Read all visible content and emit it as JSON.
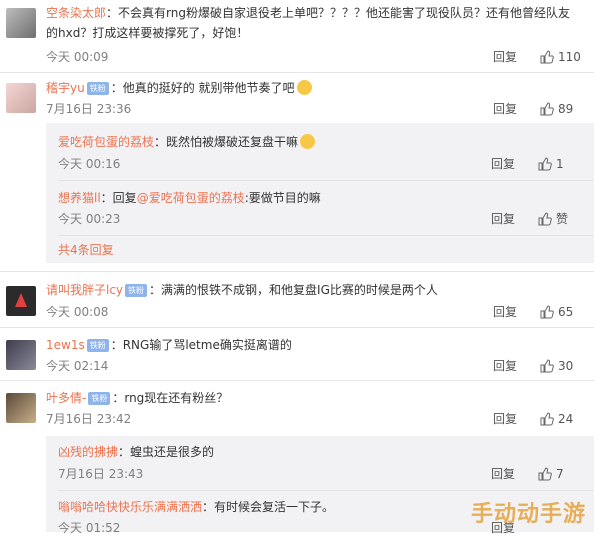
{
  "colors": {
    "username": "#eb7350",
    "badge": "#8fb4ea",
    "watermark": "#e6a23c"
  },
  "icons": {
    "like": "thumbs-up-icon"
  },
  "comments": [
    {
      "user": "空条染太郎",
      "text": "：不会真有rng粉爆破自家退役老上单吧？？？？他还能害了现役队员？还有他曾经队友的hxd？打成这样要被撑死了，好饱！",
      "time": "今天 00:09",
      "reply": "回复",
      "likes": "110"
    },
    {
      "user": "稽宇yu",
      "badge": "铁粉",
      "text": "：他真的挺好的 就别带他节奏了吧",
      "time": "7月16日 23:36",
      "reply": "回复",
      "likes": "89",
      "sub_replies": [
        {
          "user": "爱吃荷包蛋的荔枝",
          "text": "：既然怕被爆破还复盘干嘛",
          "time": "今天 00:16",
          "reply": "回复",
          "likes": "1"
        },
        {
          "user": "想养猫ll",
          "text_prefix": "：回复",
          "mention": "@爱吃荷包蛋的荔枝",
          "text_suffix": ":要做节目的嘛",
          "time": "今天 00:23",
          "reply": "回复",
          "likes": "赞"
        }
      ],
      "more": "共4条回复"
    },
    {
      "user": "请叫我胖子lcy",
      "badge": "铁粉",
      "text": "：满满的恨铁不成钢，和他复盘IG比赛的时候是两个人",
      "time": "今天 00:08",
      "reply": "回复",
      "likes": "65"
    },
    {
      "user": "1ew1s",
      "badge": "铁粉",
      "text": "：RNG输了骂letme确实挺离谱的",
      "time": "今天 02:14",
      "reply": "回复",
      "likes": "30"
    },
    {
      "user": "叶多倩-",
      "badge": "铁粉",
      "text": "：rng现在还有粉丝？",
      "time": "7月16日 23:42",
      "reply": "回复",
      "likes": "24",
      "sub_replies": [
        {
          "user": "凶残的拂拂",
          "text": "：蝗虫还是很多的",
          "time": "7月16日 23:43",
          "reply": "回复",
          "likes": "7"
        },
        {
          "user": "嗡嗡哈哈快快乐乐满满洒洒",
          "text": "：有时候会复活一下子。",
          "time": "今天 01:52",
          "reply": "回复",
          "likes": ""
        }
      ]
    }
  ],
  "watermark": "手动动手游"
}
